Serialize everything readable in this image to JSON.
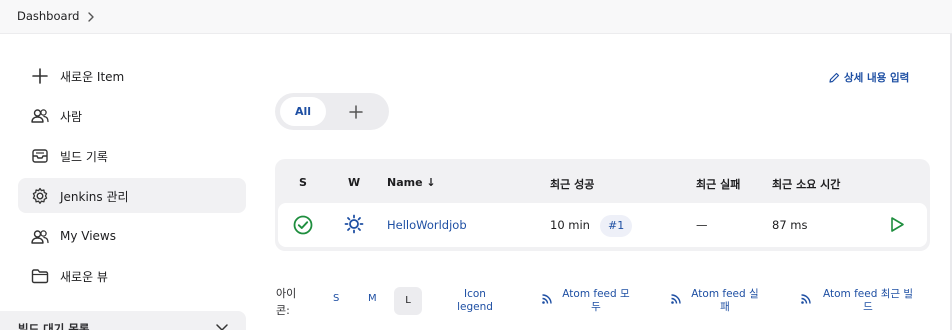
{
  "breadcrumb": {
    "dashboard": "Dashboard"
  },
  "sidebar": {
    "items": [
      {
        "label": "새로운 Item",
        "icon": "plus-icon"
      },
      {
        "label": "사람",
        "icon": "people-icon"
      },
      {
        "label": "빌드 기록",
        "icon": "inbox-icon"
      },
      {
        "label": "Jenkins 관리",
        "icon": "gear-icon"
      },
      {
        "label": "My Views",
        "icon": "people-icon"
      },
      {
        "label": "새로운 뷰",
        "icon": "folder-icon"
      }
    ],
    "build_queue": "빌드 대기 목록"
  },
  "main": {
    "edit_description": "상세 내용 입력",
    "tabs": {
      "all": "All"
    },
    "table": {
      "headers": {
        "s": "S",
        "w": "W",
        "name": "Name ↓",
        "last_success": "최근 성공",
        "last_failure": "최근 실패",
        "last_duration": "최근 소요 시간"
      },
      "rows": [
        {
          "name": "HelloWorldjob",
          "last_success": "10 min",
          "build": "#1",
          "last_failure": "—",
          "duration": "87 ms",
          "status": "success",
          "weather": "sunny"
        }
      ]
    },
    "footer": {
      "icon_label_1": "아이",
      "icon_label_2": "콘:",
      "sizes": {
        "s": "S",
        "m": "M",
        "l": "L"
      },
      "icon_legend_1": "Icon",
      "icon_legend_2": "legend",
      "feed_all_1": "Atom feed 모",
      "feed_all_2": "두",
      "feed_fail_1": "Atom feed 실",
      "feed_fail_2": "패",
      "feed_latest_1": "Atom feed 최근 빌",
      "feed_latest_2": "드"
    }
  },
  "colors": {
    "accent": "#1e4fa3",
    "success": "#1e8e3e"
  }
}
